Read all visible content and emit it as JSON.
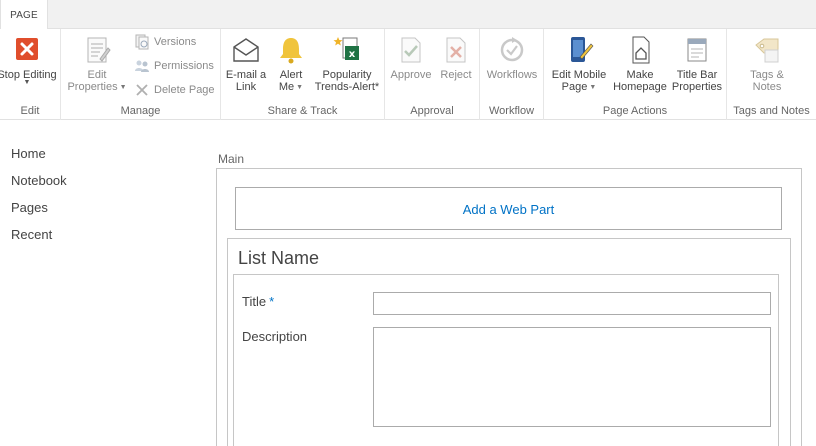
{
  "tabs": [
    {
      "label": "PAGE",
      "active": true
    }
  ],
  "ribbon": {
    "edit": {
      "group_label": "Edit",
      "stop_editing": {
        "label": "Stop Editing",
        "icon": "stop-editing-icon"
      }
    },
    "manage": {
      "group_label": "Manage",
      "edit_properties": {
        "label_line1": "Edit",
        "label_line2": "Properties",
        "icon": "edit-properties-icon"
      },
      "versions": {
        "label": "Versions",
        "icon": "versions-icon"
      },
      "permissions": {
        "label": "Permissions",
        "icon": "permissions-icon"
      },
      "delete_page": {
        "label": "Delete Page",
        "icon": "delete-page-icon"
      }
    },
    "share_track": {
      "group_label": "Share & Track",
      "email_link": {
        "label_line1": "E-mail a",
        "label_line2": "Link",
        "icon": "email-link-icon"
      },
      "alert_me": {
        "label_line1": "Alert",
        "label_line2": "Me",
        "icon": "alert-bell-icon"
      },
      "popularity": {
        "label_line1": "Popularity",
        "label_line2": "Trends-Alert*",
        "icon": "popularity-trends-icon"
      }
    },
    "approval": {
      "group_label": "Approval",
      "approve": {
        "label": "Approve",
        "icon": "approve-icon"
      },
      "reject": {
        "label": "Reject",
        "icon": "reject-icon"
      }
    },
    "workflow": {
      "group_label": "Workflow",
      "workflows": {
        "label": "Workflows",
        "icon": "workflows-icon"
      }
    },
    "page_actions": {
      "group_label": "Page Actions",
      "edit_mobile": {
        "label_line1": "Edit Mobile",
        "label_line2": "Page",
        "icon": "edit-mobile-page-icon"
      },
      "make_homepage": {
        "label_line1": "Make",
        "label_line2": "Homepage",
        "icon": "make-homepage-icon"
      },
      "title_bar": {
        "label_line1": "Title Bar",
        "label_line2": "Properties",
        "icon": "title-bar-properties-icon"
      }
    },
    "tags_notes": {
      "group_label": "Tags and Notes",
      "tags": {
        "label_line1": "Tags &",
        "label_line2": "Notes",
        "icon": "tags-notes-icon"
      }
    }
  },
  "leftnav": {
    "items": [
      "Home",
      "Notebook",
      "Pages",
      "Recent"
    ]
  },
  "main": {
    "zone_title": "Main",
    "add_web_part": "Add a Web Part",
    "webpart_title": "List Name",
    "fields": {
      "title": {
        "label": "Title",
        "required_mark": "*",
        "value": ""
      },
      "description": {
        "label": "Description",
        "value": ""
      }
    }
  },
  "colors": {
    "accent": "#0072c6",
    "stop_red": "#e04e2c",
    "bell_yellow": "#f0c43c",
    "excel_green": "#1f7244"
  }
}
